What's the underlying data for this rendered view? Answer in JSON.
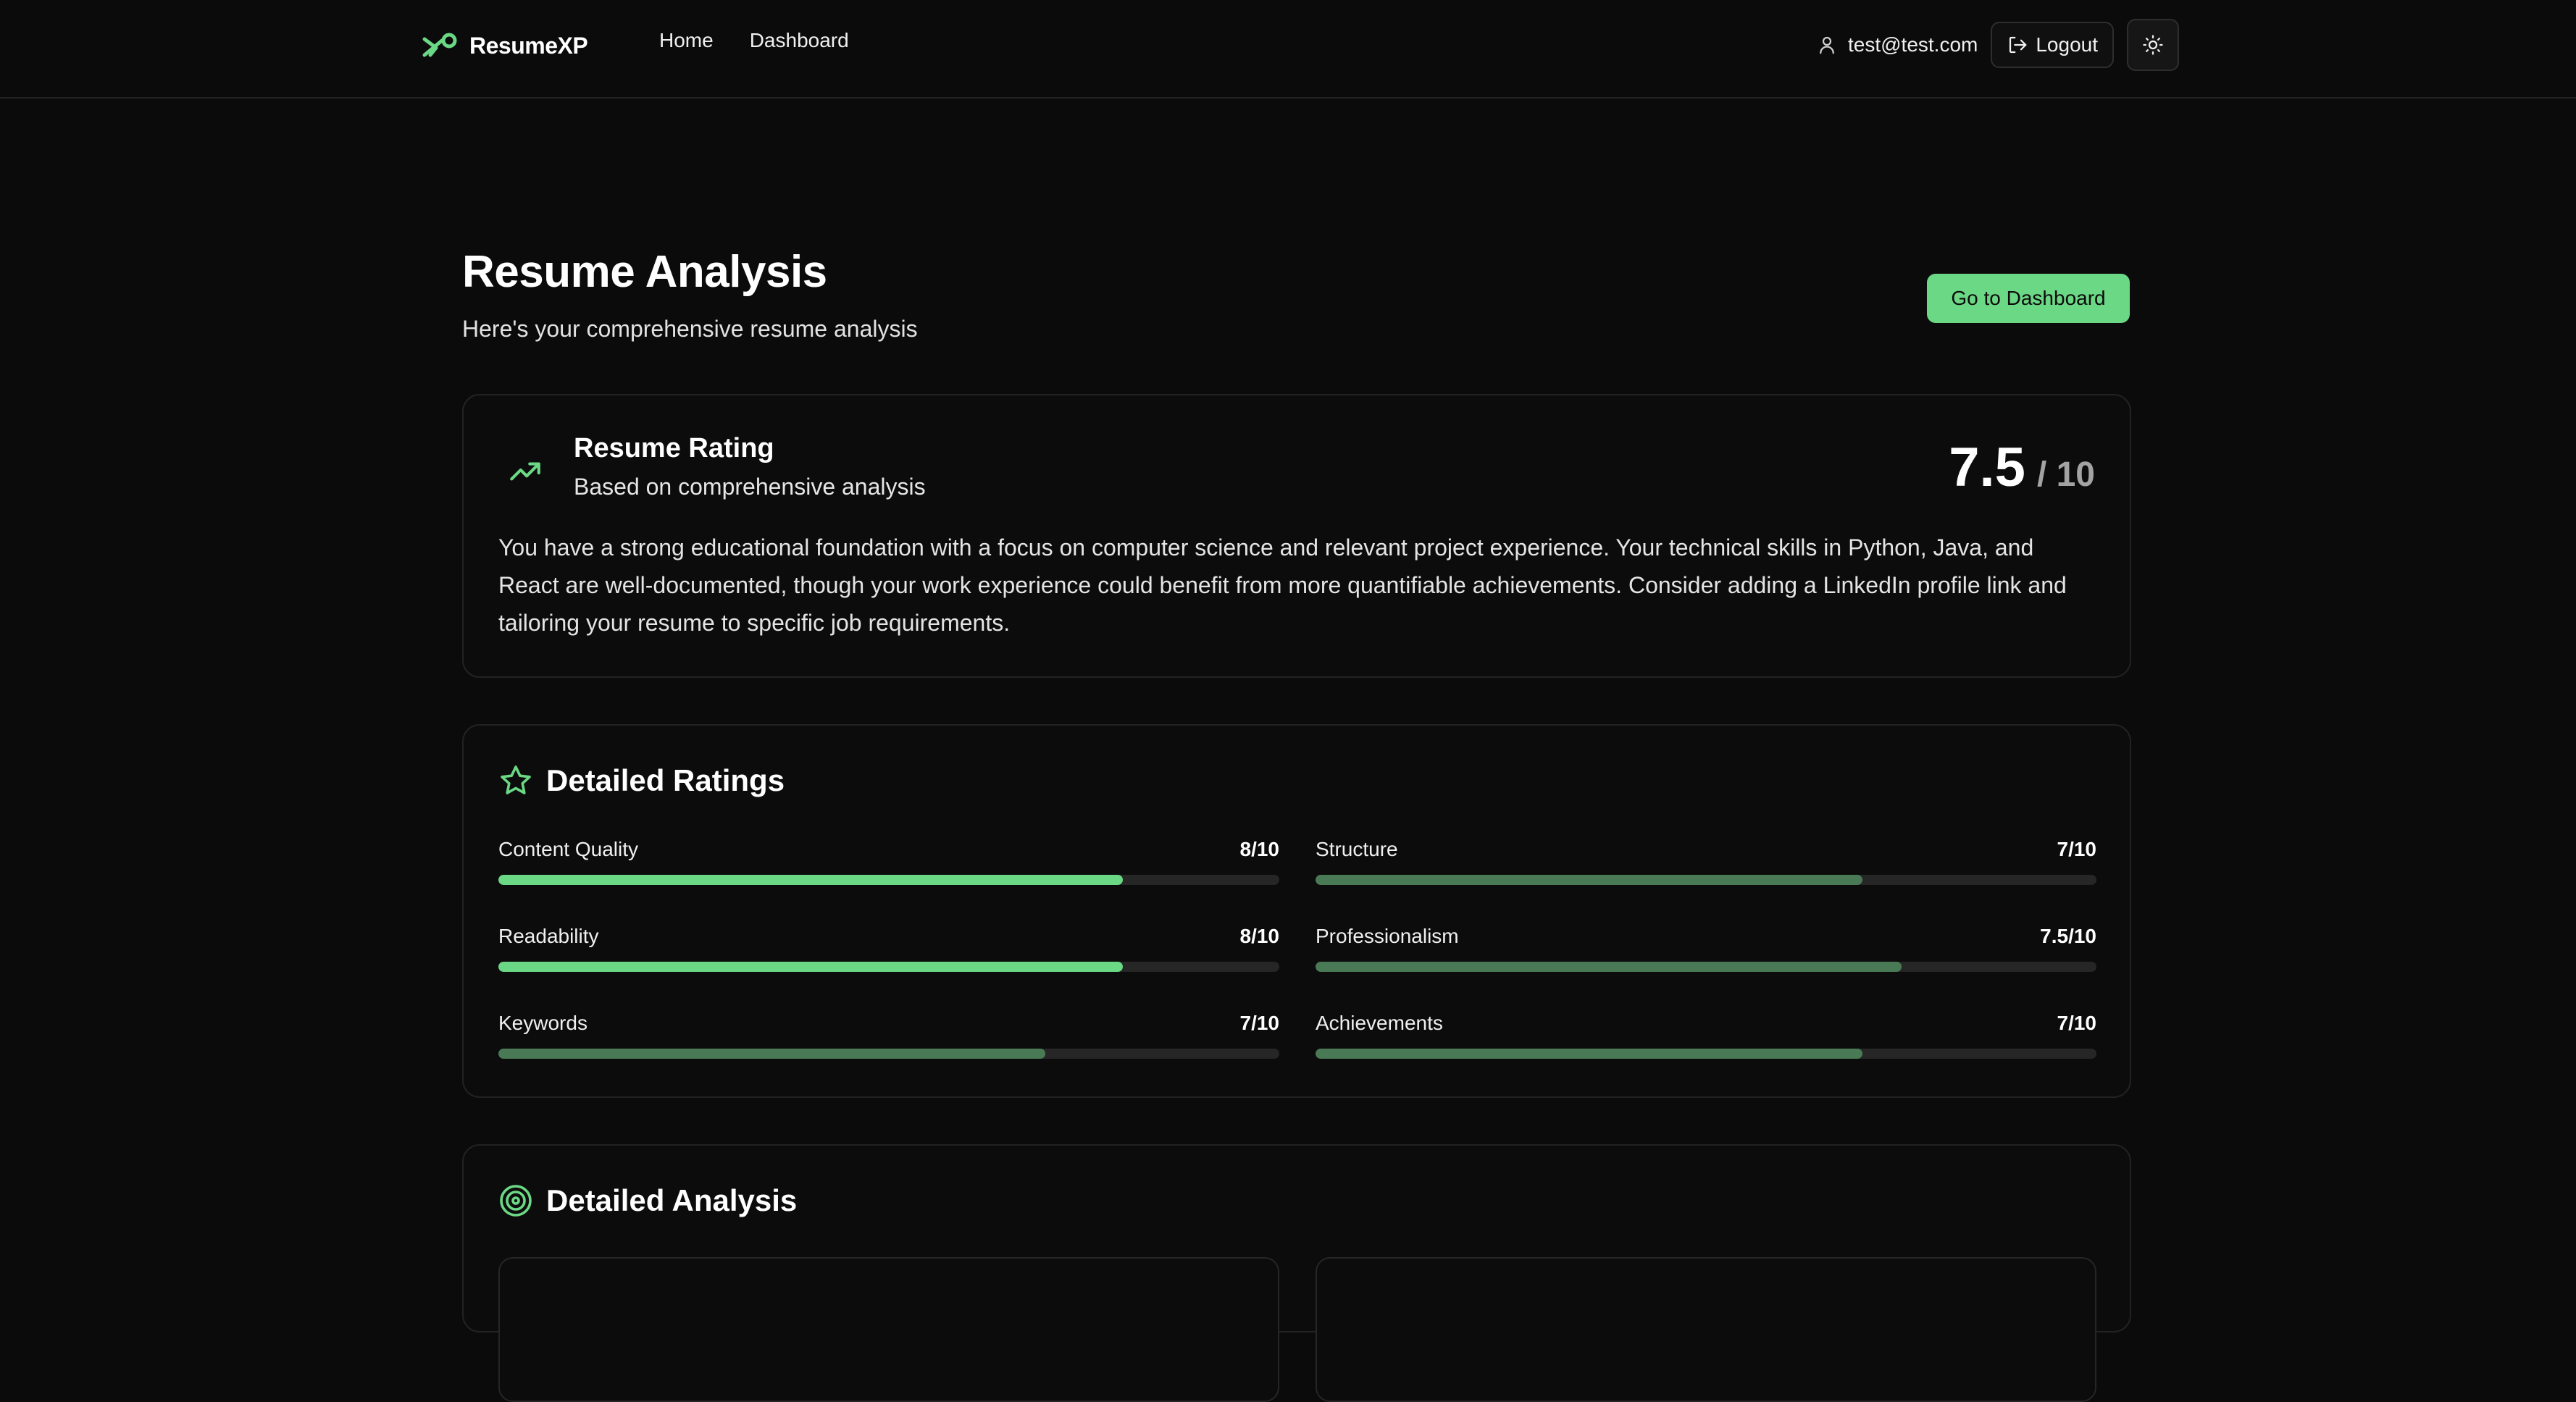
{
  "header": {
    "brand": "ResumeXP",
    "nav": [
      "Home",
      "Dashboard"
    ],
    "user_email": "test@test.com",
    "logout_label": "Logout",
    "icons": {
      "logo": "resumexp-logo-icon",
      "user": "user-icon",
      "logout": "logout-icon",
      "theme": "sun-icon"
    }
  },
  "page": {
    "title": "Resume Analysis",
    "subtitle": "Here's your comprehensive resume analysis",
    "dashboard_button": "Go to Dashboard"
  },
  "rating": {
    "title": "Resume Rating",
    "subtitle": "Based on comprehensive analysis",
    "score": "7.5",
    "max": "/ 10",
    "summary": "You have a strong educational foundation with a focus on computer science and relevant project experience. Your technical skills in Python, Java, and React are well-documented, though your work experience could benefit from more quantifiable achievements. Consider adding a LinkedIn profile link and tailoring your resume to specific job requirements.",
    "icon": "trending-up-icon"
  },
  "detailed_ratings": {
    "title": "Detailed Ratings",
    "icon": "star-icon",
    "items": [
      {
        "label": "Content Quality",
        "value": "8/10",
        "score": 8,
        "color": "#6bd885"
      },
      {
        "label": "Structure",
        "value": "7/10",
        "score": 7,
        "color": "#4a7a55"
      },
      {
        "label": "Readability",
        "value": "8/10",
        "score": 8,
        "color": "#6bd885"
      },
      {
        "label": "Professionalism",
        "value": "7.5/10",
        "score": 7.5,
        "color": "#4a7a55"
      },
      {
        "label": "Keywords",
        "value": "7/10",
        "score": 7,
        "color": "#4a7a55"
      },
      {
        "label": "Achievements",
        "value": "7/10",
        "score": 7,
        "color": "#4a7a55"
      }
    ]
  },
  "detailed_analysis": {
    "title": "Detailed Analysis",
    "icon": "target-icon"
  },
  "colors": {
    "accent": "#6bd885",
    "accent_muted": "#4a7a55",
    "background": "#0b0b0b",
    "card_border": "#222222"
  }
}
